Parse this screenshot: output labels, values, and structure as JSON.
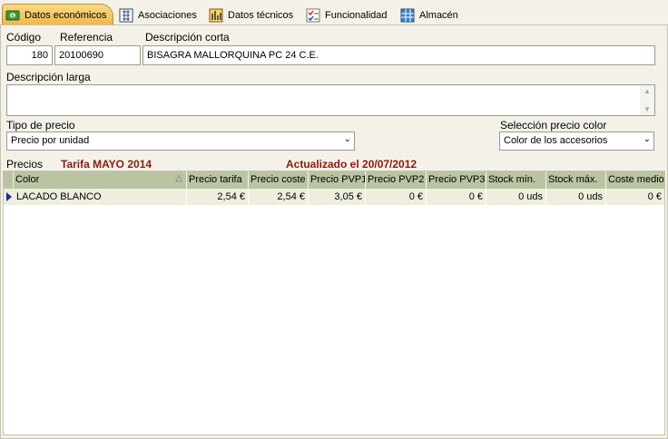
{
  "tabs": [
    {
      "label": "Datos económicos",
      "icon": "money-icon",
      "active": true
    },
    {
      "label": "Asociaciones",
      "icon": "hierarchy-icon"
    },
    {
      "label": "Datos técnicos",
      "icon": "technical-icon"
    },
    {
      "label": "Funcionalidad",
      "icon": "checklist-icon"
    },
    {
      "label": "Almacén",
      "icon": "warehouse-icon"
    }
  ],
  "form": {
    "codigo_label": "Código",
    "codigo_value": "180",
    "referencia_label": "Referencia",
    "referencia_value": "20100690",
    "desc_corta_label": "Descripción corta",
    "desc_corta_value": "BISAGRA MALLORQUINA PC 24 C.E.",
    "desc_larga_label": "Descripción larga",
    "desc_larga_value": "",
    "tipo_precio_label": "Tipo de precio",
    "tipo_precio_value": "Precio por unidad",
    "sel_color_label": "Selección precio color",
    "sel_color_value": "Color de los accesorios"
  },
  "prices": {
    "label": "Precios",
    "tarifa": "Tarifa MAYO 2014",
    "actualizado": "Actualizado el 20/07/2012",
    "columns": [
      "Color",
      "Precio tarifa",
      "Precio coste",
      "Precio PVP1",
      "Precio PVP2",
      "Precio PVP3",
      "Stock mín.",
      "Stock máx.",
      "Coste medio"
    ],
    "rows": [
      [
        "LACADO BLANCO",
        "2,54 €",
        "2,54 €",
        "3,05 €",
        "0 €",
        "0 €",
        "0 uds",
        "0 uds",
        "0 €"
      ]
    ]
  },
  "colors": {
    "tab_active": "#f2b646",
    "grid_header": "#b9c5a1",
    "accent_red": "#8b1a10"
  }
}
